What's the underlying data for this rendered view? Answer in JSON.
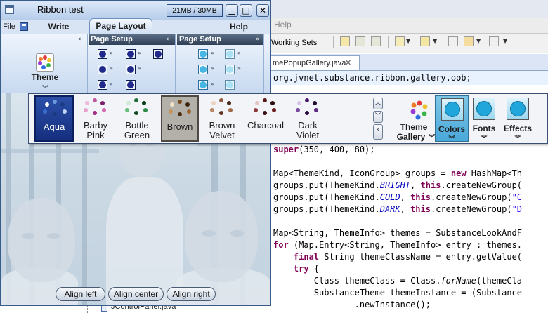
{
  "ide": {
    "menu_help": "Help",
    "working_sets_label": "Working Sets",
    "editor_tab": "mePopupGallery.java",
    "editor_tab_close": "✕",
    "code_lines": [
      {
        "segments": [
          {
            "t": "org.jvnet.substance.ribbon.gallery.oob;",
            "c": ""
          }
        ]
      },
      {
        "segments": [
          {
            "t": "",
            "c": ""
          }
        ]
      },
      {
        "segments": [
          {
            "t": "",
            "c": ""
          }
        ]
      },
      {
        "segments": [
          {
            "t": "",
            "c": ""
          }
        ]
      },
      {
        "segments": [
          {
            "t": "",
            "c": ""
          }
        ]
      },
      {
        "segments": [
          {
            "t": "",
            "c": ""
          }
        ]
      },
      {
        "segments": [
          {
            "t": "super",
            "c": "kw"
          },
          {
            "t": "(350, 400, 80);",
            "c": ""
          }
        ]
      },
      {
        "segments": [
          {
            "t": "",
            "c": ""
          }
        ]
      },
      {
        "segments": [
          {
            "t": "Map<ThemeKind, IconGroup> groups = ",
            "c": ""
          },
          {
            "t": "new",
            "c": "kw"
          },
          {
            "t": " HashMap<Th",
            "c": ""
          }
        ]
      },
      {
        "segments": [
          {
            "t": "groups.put(ThemeKind.",
            "c": ""
          },
          {
            "t": "BRIGHT",
            "c": "it"
          },
          {
            "t": ", ",
            "c": ""
          },
          {
            "t": "this",
            "c": "kw"
          },
          {
            "t": ".createNewGroup(",
            "c": ""
          }
        ]
      },
      {
        "segments": [
          {
            "t": "groups.put(ThemeKind.",
            "c": ""
          },
          {
            "t": "COLD",
            "c": "it"
          },
          {
            "t": ", ",
            "c": ""
          },
          {
            "t": "this",
            "c": "kw"
          },
          {
            "t": ".createNewGroup(",
            "c": ""
          },
          {
            "t": "\"C",
            "c": "st"
          }
        ]
      },
      {
        "segments": [
          {
            "t": "groups.put(ThemeKind.",
            "c": ""
          },
          {
            "t": "DARK",
            "c": "it"
          },
          {
            "t": ", ",
            "c": ""
          },
          {
            "t": "this",
            "c": "kw"
          },
          {
            "t": ".createNewGroup(",
            "c": ""
          },
          {
            "t": "\"D",
            "c": "st"
          }
        ]
      },
      {
        "segments": [
          {
            "t": "",
            "c": ""
          }
        ]
      },
      {
        "segments": [
          {
            "t": "Map<String, ThemeInfo> themes = SubstanceLookAndF",
            "c": ""
          }
        ]
      },
      {
        "segments": [
          {
            "t": "for",
            "c": "kw"
          },
          {
            "t": " (Map.Entry<String, ThemeInfo> entry : themes.",
            "c": ""
          }
        ]
      },
      {
        "segments": [
          {
            "t": "    ",
            "c": ""
          },
          {
            "t": "final",
            "c": "kw"
          },
          {
            "t": " String themeClassName = entry.getValue(",
            "c": ""
          }
        ]
      },
      {
        "segments": [
          {
            "t": "    ",
            "c": ""
          },
          {
            "t": "try",
            "c": "kw"
          },
          {
            "t": " {",
            "c": ""
          }
        ]
      },
      {
        "segments": [
          {
            "t": "        Class themeClass = Class.",
            "c": ""
          },
          {
            "t": "forName",
            "c": "fn"
          },
          {
            "t": "(themeCla",
            "c": ""
          }
        ]
      },
      {
        "segments": [
          {
            "t": "        SubstanceTheme themeInstance = (Substance",
            "c": ""
          }
        ]
      },
      {
        "segments": [
          {
            "t": "                .newInstance();",
            "c": ""
          }
        ]
      }
    ],
    "right_edge_fragments": [
      "p",
      "e)"
    ],
    "tree_item": "JControlPanel.java"
  },
  "window": {
    "title": "Ribbon test",
    "memory": "21MB / 30MB",
    "min_glyph": "▁",
    "max_glyph": "□",
    "close_glyph": "✕"
  },
  "ribbon": {
    "tabs": {
      "file": "File",
      "write": "Write",
      "page_layout": "Page Layout",
      "help": "Help"
    },
    "theme_button": "Theme",
    "bands": [
      {
        "title": "Page Setup"
      },
      {
        "title": "Page Setup"
      }
    ],
    "expand_glyph": "»",
    "drop_glyph": "»"
  },
  "footer": {
    "align_left": "Align left",
    "align_center": "Align center",
    "align_right": "Align right"
  },
  "gallery": {
    "items": [
      {
        "label_1": "Aqua",
        "label_2": "",
        "selected": true
      },
      {
        "label_1": "Barby",
        "label_2": "Pink",
        "selected": false
      },
      {
        "label_1": "Bottle",
        "label_2": "Green",
        "selected": false
      },
      {
        "label_1": "Brown",
        "label_2": "",
        "selected": true
      },
      {
        "label_1": "Brown",
        "label_2": "Velvet",
        "selected": false
      },
      {
        "label_1": "Charcoal",
        "label_2": "",
        "selected": false
      },
      {
        "label_1": "Dark",
        "label_2": "Violet",
        "selected": false
      }
    ],
    "scroll_up": "︿",
    "scroll_down": "﹀",
    "scroll_expand": "»",
    "theme_gallery_1": "Theme",
    "theme_gallery_2": "Gallery",
    "colors": "Colors",
    "fonts": "Fonts",
    "effects": "Effects",
    "dropdown_glyph": "»"
  },
  "colors": {
    "accent_blue": "#1f3a93",
    "selected_cyan": "#4aa8d9",
    "keyword": "#7f0055",
    "string": "#2a00ff",
    "constant": "#0000c0"
  }
}
